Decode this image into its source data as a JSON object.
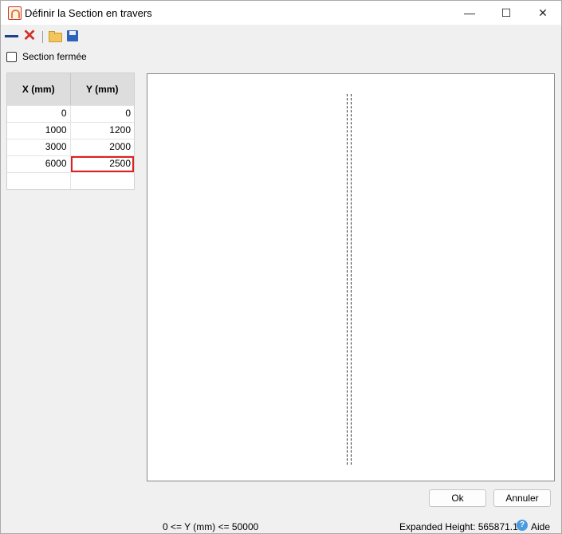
{
  "window": {
    "title": "Définir la Section en travers"
  },
  "closed_section": {
    "label": "Section fermée",
    "checked": false
  },
  "table": {
    "headers": [
      "X (mm)",
      "Y (mm)"
    ],
    "rows": [
      [
        "0",
        "0"
      ],
      [
        "1000",
        "1200"
      ],
      [
        "3000",
        "2000"
      ],
      [
        "6000",
        "2500"
      ],
      [
        "",
        ""
      ]
    ]
  },
  "buttons": {
    "ok": "Ok",
    "cancel": "Annuler"
  },
  "status": {
    "range": "0 <= Y (mm) <= 50000",
    "expanded_height_label": "Expanded Height:",
    "expanded_height_value": "565871.15",
    "help": "Aide"
  },
  "icons": {
    "minimize": "minimize-icon",
    "maximize": "maximize-icon",
    "close": "close-icon",
    "add_line": "line-icon",
    "delete": "delete-icon",
    "open": "folder-open-icon",
    "save": "save-icon",
    "help": "help-icon"
  },
  "colors": {
    "selection": "#e02020",
    "save": "#2d63b8",
    "delete": "#d0302a"
  }
}
